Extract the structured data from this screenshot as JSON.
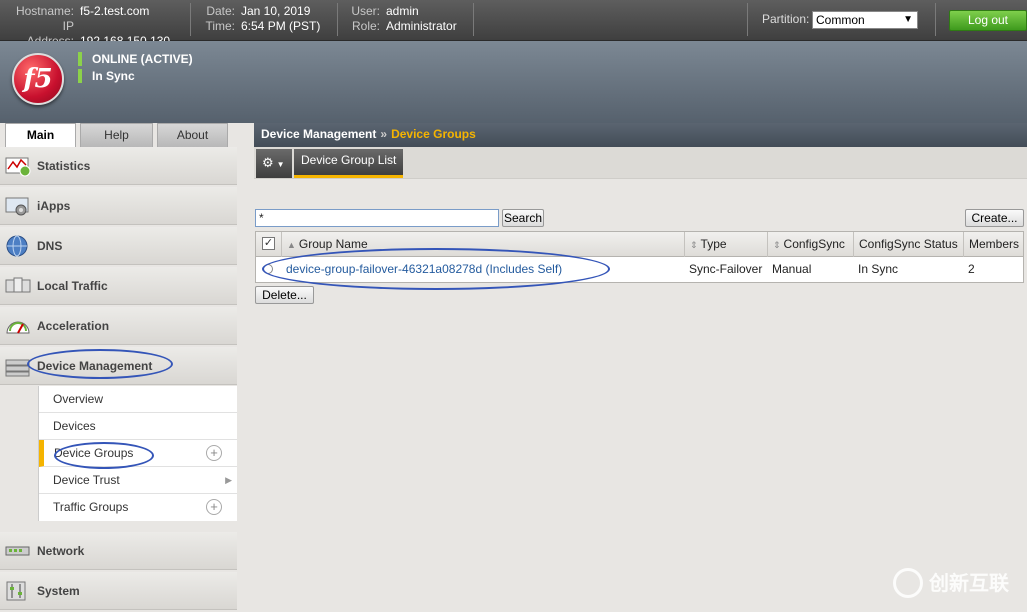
{
  "topbar": {
    "hostname_label": "Hostname:",
    "hostname": "f5-2.test.com",
    "ip_label": "IP Address:",
    "ip": "192.168.150.130",
    "date_label": "Date:",
    "date": "Jan 10, 2019",
    "time_label": "Time:",
    "time": "6:54 PM (PST)",
    "user_label": "User:",
    "user": "admin",
    "role_label": "Role:",
    "role": "Administrator",
    "partition_label": "Partition:",
    "partition_value": "Common",
    "logout_label": "Log out"
  },
  "header": {
    "logo_text": "f5",
    "status_online": "ONLINE (ACTIVE)",
    "status_sync": "In Sync"
  },
  "nav_tabs": [
    "Main",
    "Help",
    "About"
  ],
  "sidebar": {
    "items": [
      "Statistics",
      "iApps",
      "DNS",
      "Local Traffic",
      "Acceleration",
      "Device Management",
      "Network",
      "System"
    ],
    "sub_items": [
      "Overview",
      "Devices",
      "Device Groups",
      "Device Trust",
      "Traffic Groups"
    ]
  },
  "breadcrumb": {
    "parent": "Device Management",
    "separator": "»",
    "current": "Device Groups"
  },
  "subtab": {
    "label": "Device Group List"
  },
  "content": {
    "filter_value": "*",
    "search_label": "Search",
    "create_label": "Create...",
    "delete_label": "Delete...",
    "columns": [
      "Group Name",
      "Type",
      "ConfigSync",
      "ConfigSync Status",
      "Members"
    ],
    "rows": [
      {
        "name": "device-group-failover-46321a08278d (Includes Self)",
        "type": "Sync-Failover",
        "configsync": "Manual",
        "status": "In Sync",
        "members": "2"
      }
    ]
  },
  "watermark": "创新互联",
  "colors": {
    "accent": "#f5b400",
    "online": "#8cd24a",
    "annotation": "#3455b8",
    "link": "#245b9e"
  }
}
